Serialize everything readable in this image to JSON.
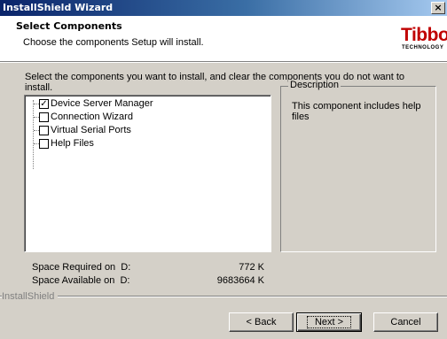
{
  "window": {
    "title": "InstallShield Wizard",
    "close_glyph": "×"
  },
  "header": {
    "title": "Select Components",
    "subtitle": "Choose the components Setup will install.",
    "logo_text": "Tibbo",
    "logo_subtext": "TECHNOLOGY"
  },
  "instructions": "Select the components you want to install, and clear the components you do not want to install.",
  "components": [
    {
      "label": "Device Server Manager",
      "checked": true,
      "check_glyph": "✓"
    },
    {
      "label": "Connection Wizard",
      "checked": false,
      "check_glyph": ""
    },
    {
      "label": "Virtual Serial Ports",
      "checked": false,
      "check_glyph": ""
    },
    {
      "label": "Help Files",
      "checked": false,
      "check_glyph": ""
    }
  ],
  "description": {
    "legend": "Description",
    "text": "This component includes help files"
  },
  "space": {
    "required_label": "Space Required on  D:",
    "required_value": "772 K",
    "available_label": "Space Available on  D:",
    "available_value": "9683664 K"
  },
  "footer": {
    "brand": "InstallShield"
  },
  "buttons": {
    "back": "< Back",
    "next": "Next >",
    "cancel": "Cancel"
  }
}
